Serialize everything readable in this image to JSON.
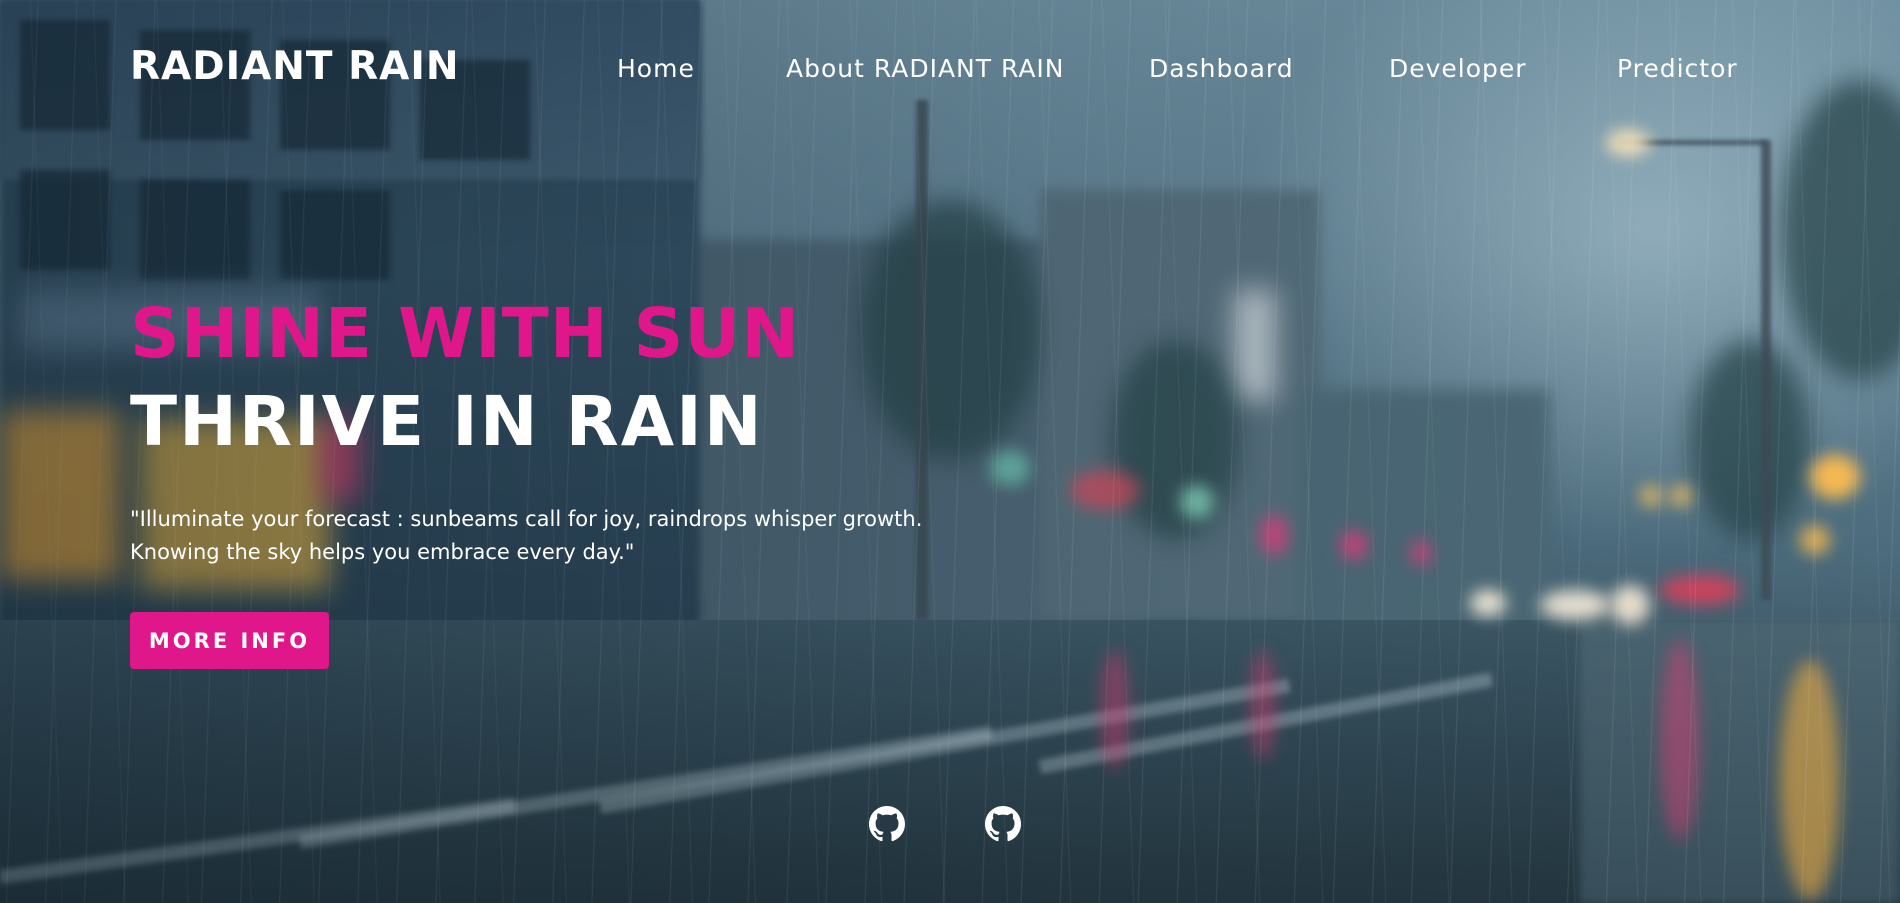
{
  "brand": {
    "name": "RADIANT RAIN"
  },
  "nav": {
    "items": [
      {
        "label": "Home"
      },
      {
        "label": "About RADIANT RAIN"
      },
      {
        "label": "Dashboard"
      },
      {
        "label": "Developer"
      },
      {
        "label": "Predictor"
      }
    ]
  },
  "hero": {
    "headline_accent": "SHINE WITH SUN",
    "headline_main": "THRIVE IN RAIN",
    "quote_line1": "\"Illuminate your forecast : sunbeams call for joy, raindrops whisper growth.",
    "quote_line2": "Knowing the sky helps you embrace every day.\"",
    "cta_label": "MORE INFO"
  },
  "social": {
    "links": [
      {
        "icon": "github-icon"
      },
      {
        "icon": "github-icon"
      }
    ]
  },
  "colors": {
    "accent": "#e0178a",
    "text": "#ffffff",
    "background": "#4d6d7e"
  }
}
